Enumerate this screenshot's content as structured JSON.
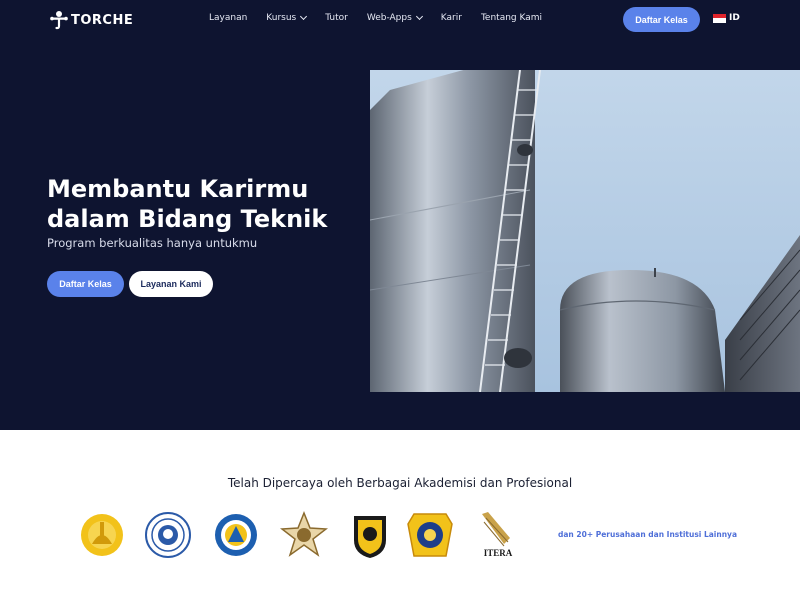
{
  "brand": {
    "name": "TORCHE"
  },
  "nav": {
    "links": [
      {
        "label": "Layanan"
      },
      {
        "label": "Kursus"
      },
      {
        "label": "Tutor"
      },
      {
        "label": "Web-Apps"
      },
      {
        "label": "Karir"
      },
      {
        "label": "Tentang Kami"
      }
    ],
    "cta_label": "Daftar Kelas",
    "language": "ID"
  },
  "hero": {
    "title_line1": "Membantu Karirmu",
    "title_line2": "dalam Bidang Teknik",
    "subtitle": "Program berkualitas hanya untukmu",
    "primary_button": "Daftar Kelas",
    "secondary_button": "Layanan Kami"
  },
  "partners": {
    "heading": "Telah Dipercaya oleh Berbagai Akademisi dan Profesional",
    "itera_label": "ITERA",
    "more_label": "dan 20+ Perusahaan dan Institusi Lainnya"
  },
  "colors": {
    "hero_bg": "#0e1430",
    "accent": "#5a82ea",
    "link_blue": "#4f6fd8"
  }
}
